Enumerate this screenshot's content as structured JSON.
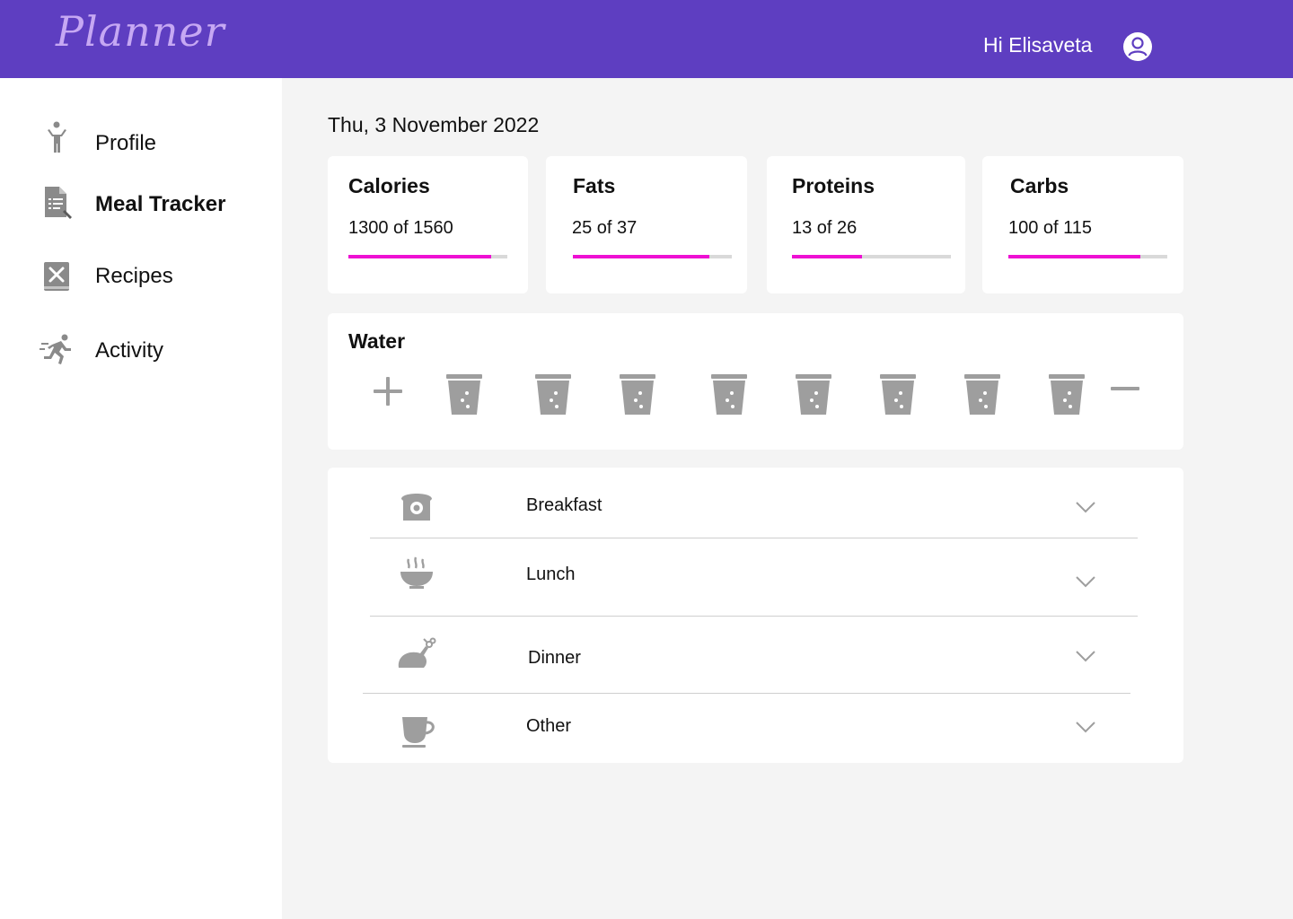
{
  "header": {
    "logo_text": "Planner",
    "greeting": "Hi Elisaveta",
    "avatar_icon": "user-circle-icon",
    "background_color": "#5e3ec1"
  },
  "sidebar": {
    "items": [
      {
        "label": "Profile",
        "icon": "person-standing-icon",
        "active": false
      },
      {
        "label": "Meal Tracker",
        "icon": "document-list-icon",
        "active": true
      },
      {
        "label": "Recipes",
        "icon": "utensils-book-icon",
        "active": false
      },
      {
        "label": "Activity",
        "icon": "running-person-icon",
        "active": false
      }
    ]
  },
  "main": {
    "date": "Thu, 3 November 2022",
    "nutrients": [
      {
        "title": "Calories",
        "value_text": "1300 of 1560",
        "progress": 0.9
      },
      {
        "title": "Fats",
        "value_text": "25 of 37",
        "progress": 0.86
      },
      {
        "title": "Proteins",
        "value_text": "13 of 26",
        "progress": 0.44
      },
      {
        "title": "Carbs",
        "value_text": "100 of 115",
        "progress": 0.83
      }
    ],
    "progress_color": "#ee10d3",
    "water": {
      "title": "Water",
      "glasses": 8,
      "add_icon": "plus-icon",
      "remove_icon": "minus-icon",
      "glass_icon": "water-glass-icon"
    },
    "meals": [
      {
        "label": "Breakfast",
        "icon": "toast-icon"
      },
      {
        "label": "Lunch",
        "icon": "soup-bowl-icon"
      },
      {
        "label": "Dinner",
        "icon": "roast-chicken-icon"
      },
      {
        "label": "Other",
        "icon": "coffee-cup-icon"
      }
    ]
  }
}
